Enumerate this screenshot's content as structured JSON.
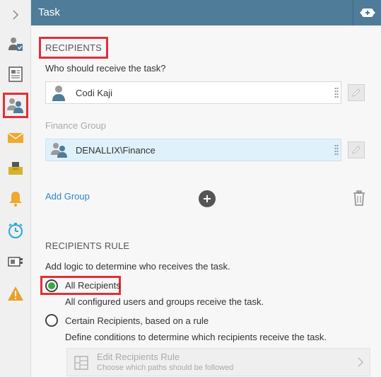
{
  "header": {
    "title": "Task"
  },
  "recipients": {
    "section_title": "RECIPIENTS",
    "prompt": "Who should receive the task?",
    "user": {
      "name": "Codi Kaji"
    },
    "group_label": "Finance Group",
    "group": {
      "name": "DENALLIX\\Finance"
    },
    "add_group_label": "Add Group"
  },
  "rule": {
    "section_title": "RECIPIENTS RULE",
    "description": "Add logic to determine who receives the task.",
    "options": [
      {
        "label": "All Recipients",
        "hint": "All configured users and groups receive the task.",
        "selected": true
      },
      {
        "label": "Certain Recipients, based on a rule",
        "hint": "Define conditions to determine which recipients receive the task.",
        "selected": false
      }
    ],
    "edit": {
      "title": "Edit Recipients Rule",
      "subtitle": "Choose which paths should be followed"
    }
  },
  "sidebar": {
    "items": [
      {
        "icon": "chevron-right-icon"
      },
      {
        "icon": "user-task-icon"
      },
      {
        "icon": "form-icon"
      },
      {
        "icon": "recipients-icon",
        "active": true
      },
      {
        "icon": "email-icon"
      },
      {
        "icon": "inbox-icon"
      },
      {
        "icon": "bell-icon"
      },
      {
        "icon": "stopwatch-icon"
      },
      {
        "icon": "screen-icon"
      },
      {
        "icon": "warning-icon"
      }
    ]
  },
  "colors": {
    "header": "#4f7c98",
    "accent_link": "#2a87c8",
    "highlight": "#e0303a",
    "radio_selected": "#3aa845",
    "warning": "#e8a02a",
    "clock": "#2aa6d8"
  }
}
